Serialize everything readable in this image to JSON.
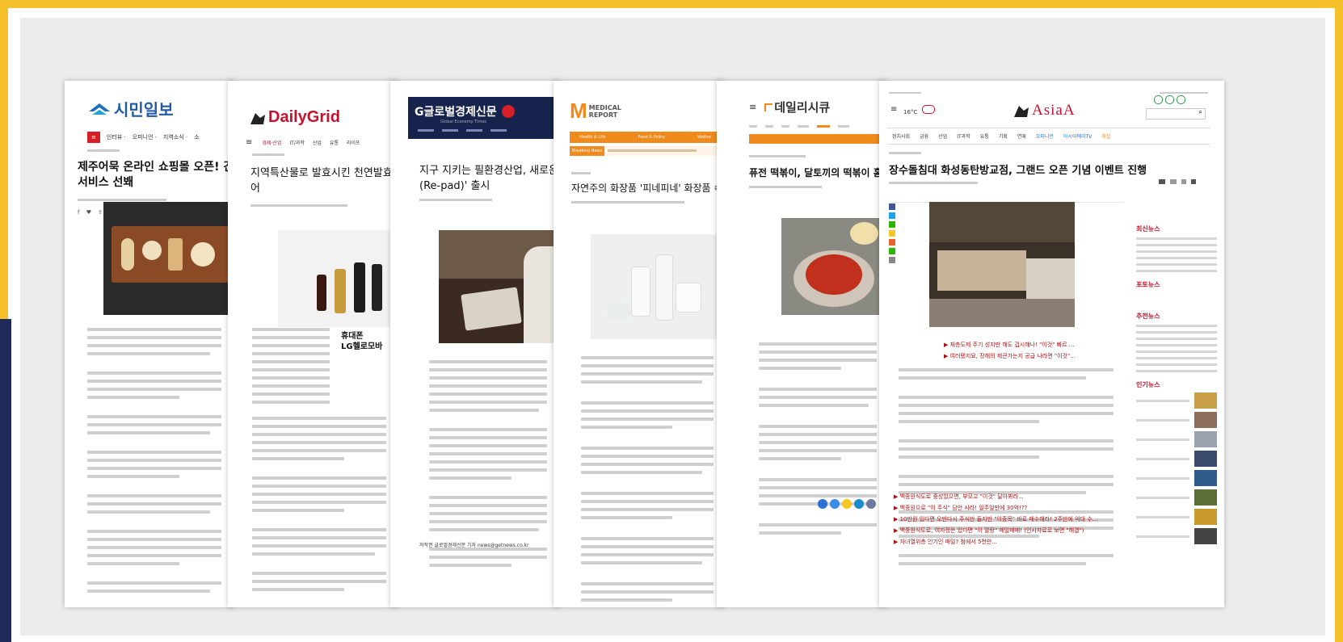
{
  "pages": [
    {
      "logo": "시민일보",
      "nav": [
        "인터뷰 ·",
        "오피니언 ·",
        "지역소식 ·",
        "소"
      ],
      "headline_1": "제주어묵 온라인 쇼핑몰 오픈! 간",
      "headline_2": "서비스 선봬"
    },
    {
      "logo": "DailyGrid",
      "nav": [
        "경제·산업",
        "IT/과학",
        "산업",
        "유통",
        "라이프"
      ],
      "headline_1": "지역특산물로 발효시킨 천연발효식초,",
      "headline_2": "어",
      "ad_title": "휴대폰",
      "ad_subtitle": "LG헬로모바"
    },
    {
      "logo": "G글로벌경제신문",
      "logo_sub": "Global Economy Times",
      "headline_1": "지구 지키는 필환경산업, 새로운 문화",
      "headline_2": "(Re-pad)' 출시",
      "footer": "저작권 글로벌경제신문 기자 news@getnews.co.kr"
    },
    {
      "logo": "MEDICAL REPORT",
      "tabs": [
        "Health & Life",
        "Food & Policy",
        "Wellne"
      ],
      "breaking": "Breaking News",
      "headline_1": "자연주의 화장품 '피네피네' 화장품 속 건조"
    },
    {
      "logo": "데일리시큐",
      "headline_1": "퓨전 떡볶이, 달토끼의 떡볶이 홈입구역"
    },
    {
      "weather": "16°C",
      "logo": "AsiaA",
      "nav": [
        "정치사회",
        "금융",
        "산업",
        "IT과학",
        "유통",
        "기획",
        "연재",
        "오피니언",
        "아시아에이TV",
        "해설"
      ],
      "headline": "장수돌침대 화성동탄방교점, 그랜드 오픈 기념 이벤트 진행",
      "sidebar_titles": [
        "최신뉴스",
        "포토뉴스",
        "추천뉴스",
        "인기뉴스"
      ],
      "highlight_items": [
        "▶ 재층도제 주기 성지만 해도 겁시해나! \"이것\" 빠르 ...",
        "▶ 여러됐지요, 장해의 제큰가는지 공급 나라면 \"이것\"..."
      ],
      "related_items": [
        "▶ 백종원식도로 중성있으면, 부모고 \"이것\" 달아봐라...",
        "▶ 백종원으로 \"이 주식\" 담언 사라! 일주일만에 30억!??",
        "▶ 10만원 있다면 오만다시 주식만 들지만 \"이종목\" 바로 매수해라! 2주만에 억대 수...",
        "▶ 백종원식도로, 여자정은 있다면 \"이 말랑\" 매일매매! (인사자료로 보면 \"해결\")",
        "▶ 자녀열위층 인기인 매일? 첨에서 5천만..."
      ]
    }
  ],
  "colors": {
    "frame": "#f6c02a",
    "background": "#ececec",
    "accent_red": "#c8102e",
    "navy": "#1e2a5a"
  }
}
